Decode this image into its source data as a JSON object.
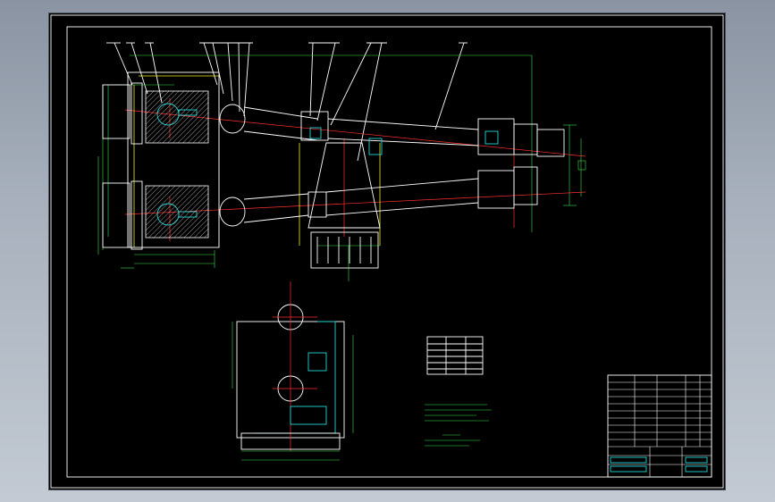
{
  "drawing": {
    "background": "#000000",
    "border_color": "#ffffff",
    "line_colors": {
      "outline": "#ffffff",
      "dimension": "#3fe04a",
      "centerline": "#ff3030",
      "hidden": "#f3ee2a",
      "section": "#25d6d6"
    }
  },
  "views": [
    "main-view",
    "side-view",
    "parts-table",
    "notes",
    "title-block"
  ]
}
